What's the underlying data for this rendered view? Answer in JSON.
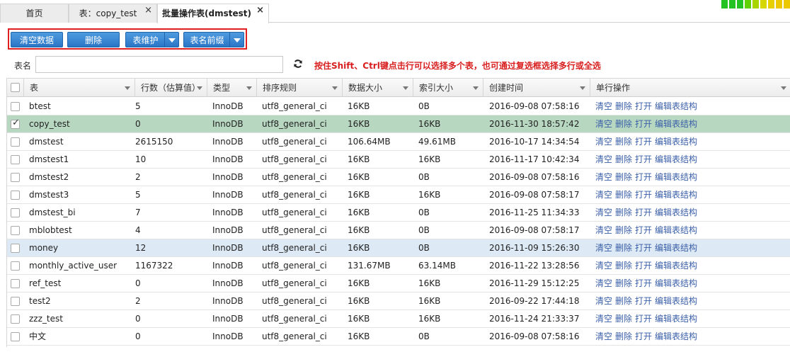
{
  "tabs": [
    {
      "label": "首页",
      "closable": false,
      "active": false
    },
    {
      "label": "表：copy_test",
      "closable": true,
      "active": false
    },
    {
      "label": "批量操作表(dmstest)",
      "closable": true,
      "active": true
    }
  ],
  "toolbar": {
    "clear_label": "清空数据",
    "delete_label": "删除",
    "maintain_label": "表维护",
    "prefix_label": "表名前缀"
  },
  "search": {
    "label": "表名",
    "value": "",
    "placeholder": "",
    "hint": "按住Shift、Ctrl键点击行可以选择多个表，也可通过复选框选择多行或全选"
  },
  "columns": [
    "表",
    "行数（估算值）",
    "类型",
    "排序规则",
    "数据大小",
    "索引大小",
    "创建时间",
    "单行操作"
  ],
  "row_ops": [
    "清空",
    "删除",
    "打开",
    "编辑表结构"
  ],
  "rows": [
    {
      "name": "btest",
      "rows": "5",
      "type": "InnoDB",
      "collation": "utf8_general_ci",
      "data_size": "16KB",
      "index_size": "0B",
      "created": "2016-09-08 07:58:16",
      "checked": false,
      "state": ""
    },
    {
      "name": "copy_test",
      "rows": "0",
      "type": "InnoDB",
      "collation": "utf8_general_ci",
      "data_size": "16KB",
      "index_size": "16KB",
      "created": "2016-11-30 18:57:42",
      "checked": true,
      "state": "selected"
    },
    {
      "name": "dmstest",
      "rows": "2615150",
      "type": "InnoDB",
      "collation": "utf8_general_ci",
      "data_size": "106.64MB",
      "index_size": "49.61MB",
      "created": "2016-10-17 14:34:54",
      "checked": false,
      "state": ""
    },
    {
      "name": "dmstest1",
      "rows": "10",
      "type": "InnoDB",
      "collation": "utf8_general_ci",
      "data_size": "16KB",
      "index_size": "16KB",
      "created": "2016-11-17 10:42:34",
      "checked": false,
      "state": ""
    },
    {
      "name": "dmstest2",
      "rows": "2",
      "type": "InnoDB",
      "collation": "utf8_general_ci",
      "data_size": "16KB",
      "index_size": "0B",
      "created": "2016-09-08 07:58:16",
      "checked": false,
      "state": ""
    },
    {
      "name": "dmstest3",
      "rows": "5",
      "type": "InnoDB",
      "collation": "utf8_general_ci",
      "data_size": "16KB",
      "index_size": "16KB",
      "created": "2016-09-08 07:58:17",
      "checked": false,
      "state": ""
    },
    {
      "name": "dmstest_bi",
      "rows": "7",
      "type": "InnoDB",
      "collation": "utf8_general_ci",
      "data_size": "16KB",
      "index_size": "0B",
      "created": "2016-11-25 11:34:33",
      "checked": false,
      "state": ""
    },
    {
      "name": "mblobtest",
      "rows": "4",
      "type": "InnoDB",
      "collation": "utf8_general_ci",
      "data_size": "16KB",
      "index_size": "0B",
      "created": "2016-09-08 07:58:17",
      "checked": false,
      "state": ""
    },
    {
      "name": "money",
      "rows": "12",
      "type": "InnoDB",
      "collation": "utf8_general_ci",
      "data_size": "16KB",
      "index_size": "0B",
      "created": "2016-11-09 15:26:30",
      "checked": false,
      "state": "hover"
    },
    {
      "name": "monthly_active_user",
      "rows": "1167322",
      "type": "InnoDB",
      "collation": "utf8_general_ci",
      "data_size": "131.67MB",
      "index_size": "63.14MB",
      "created": "2016-11-22 13:28:56",
      "checked": false,
      "state": ""
    },
    {
      "name": "ref_test",
      "rows": "0",
      "type": "InnoDB",
      "collation": "utf8_general_ci",
      "data_size": "16KB",
      "index_size": "16KB",
      "created": "2016-11-29 15:12:25",
      "checked": false,
      "state": ""
    },
    {
      "name": "test2",
      "rows": "2",
      "type": "InnoDB",
      "collation": "utf8_general_ci",
      "data_size": "16KB",
      "index_size": "16KB",
      "created": "2016-09-22 17:44:18",
      "checked": false,
      "state": ""
    },
    {
      "name": "zzz_test",
      "rows": "0",
      "type": "InnoDB",
      "collation": "utf8_general_ci",
      "data_size": "16KB",
      "index_size": "16KB",
      "created": "2016-11-24 21:33:37",
      "checked": false,
      "state": ""
    },
    {
      "name": "中文",
      "rows": "0",
      "type": "InnoDB",
      "collation": "utf8_general_ci",
      "data_size": "16KB",
      "index_size": "0B",
      "created": "2016-09-08 07:58:16",
      "checked": false,
      "state": ""
    }
  ],
  "colors": {
    "accent": "#2a76c6",
    "highlight_border": "#e02020",
    "selected_row": "#b7d7c1",
    "hover_row": "#dde9f4",
    "hint_text": "#d81e1e",
    "link": "#3a5fa8"
  },
  "icons": {
    "refresh": "refresh-icon",
    "dropdown": "caret-down-icon",
    "close": "close-icon",
    "checkbox": "checkbox-icon"
  }
}
